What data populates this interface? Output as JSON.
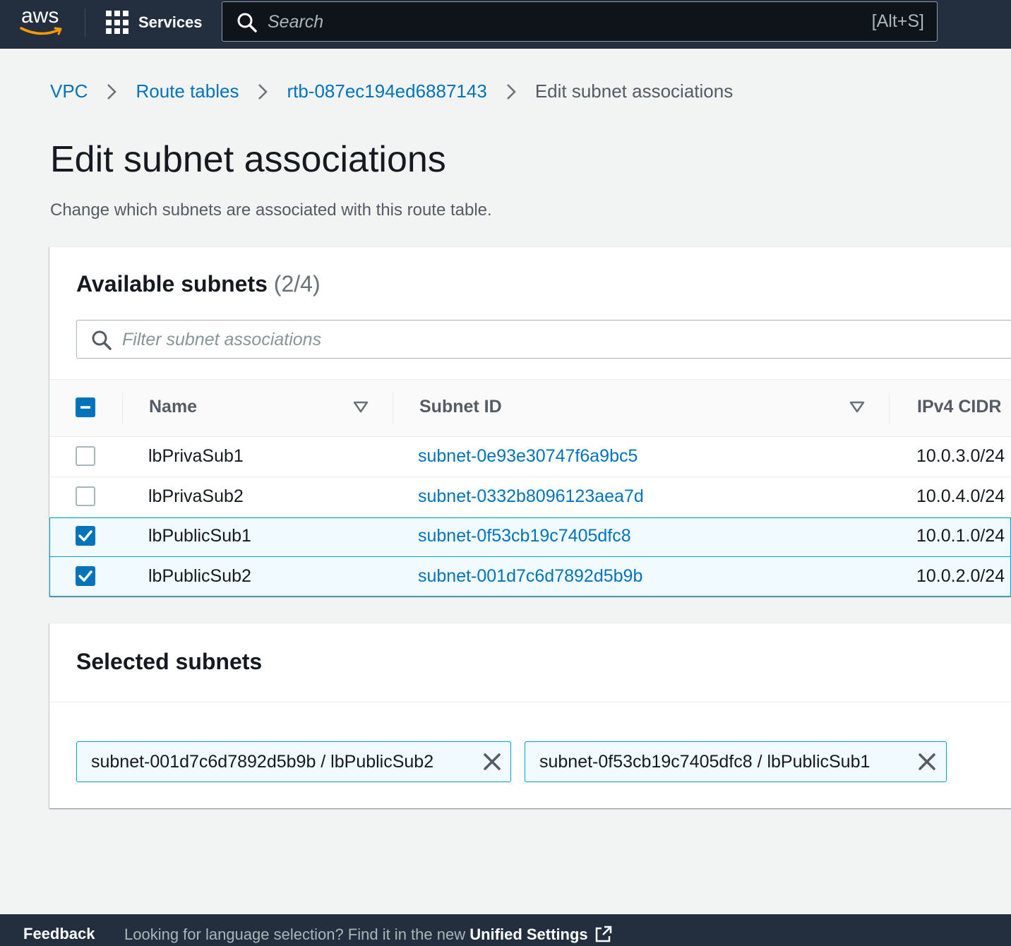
{
  "topnav": {
    "logo_text": "aws",
    "services_label": "Services",
    "search_placeholder": "Search",
    "search_shortcut": "[Alt+S]"
  },
  "breadcrumb": {
    "items": [
      "VPC",
      "Route tables",
      "rtb-087ec194ed6887143"
    ],
    "current": "Edit subnet associations"
  },
  "page": {
    "title": "Edit subnet associations",
    "description": "Change which subnets are associated with this route table."
  },
  "available": {
    "title": "Available subnets",
    "count": "(2/4)",
    "filter_placeholder": "Filter subnet associations",
    "columns": [
      "Name",
      "Subnet ID",
      "IPv4 CIDR"
    ],
    "header_checkbox_state": "indeterminate",
    "rows": [
      {
        "name": "lbPrivaSub1",
        "subnet_id": "subnet-0e93e30747f6a9bc5",
        "cidr": "10.0.3.0/24",
        "checked": false
      },
      {
        "name": "lbPrivaSub2",
        "subnet_id": "subnet-0332b8096123aea7d",
        "cidr": "10.0.4.0/24",
        "checked": false
      },
      {
        "name": "lbPublicSub1",
        "subnet_id": "subnet-0f53cb19c7405dfc8",
        "cidr": "10.0.1.0/24",
        "checked": true
      },
      {
        "name": "lbPublicSub2",
        "subnet_id": "subnet-001d7c6d7892d5b9b",
        "cidr": "10.0.2.0/24",
        "checked": true
      }
    ]
  },
  "selected": {
    "title": "Selected subnets",
    "tokens": [
      "subnet-001d7c6d7892d5b9b / lbPublicSub2",
      "subnet-0f53cb19c7405dfc8 / lbPublicSub1"
    ]
  },
  "footer": {
    "feedback": "Feedback",
    "lang_text": "Looking for language selection? Find it in the new ",
    "lang_link": "Unified Settings"
  },
  "colors": {
    "nav_bg": "#232f3e",
    "link": "#0073bb",
    "selected_row_bg": "#f1faff",
    "selected_border": "#00a1c9",
    "aws_orange": "#ff9900"
  }
}
